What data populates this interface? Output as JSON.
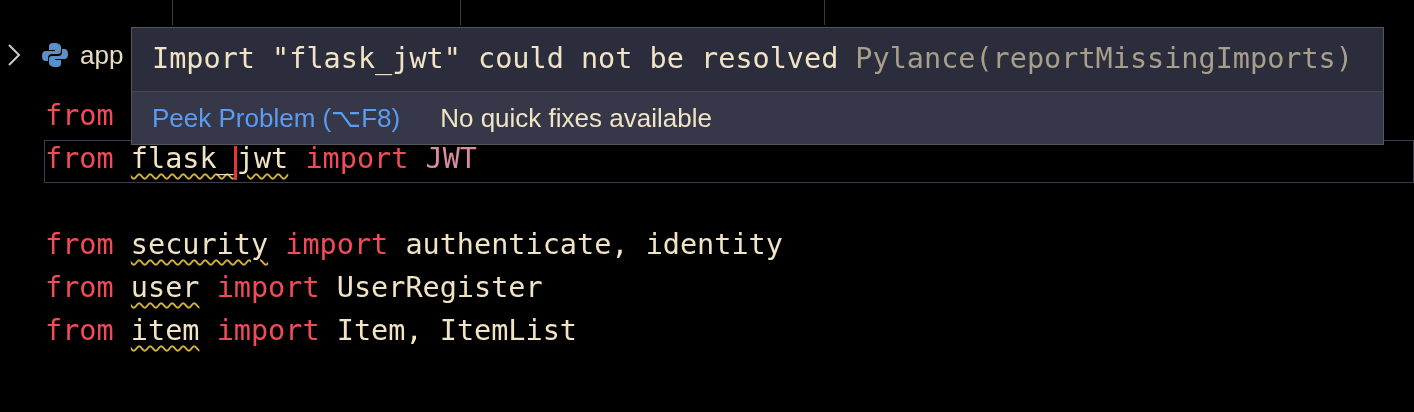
{
  "breadcrumb": {
    "items": [
      "app"
    ]
  },
  "editor": {
    "lines": [
      {
        "kind": "code",
        "current": false,
        "tokens": [
          {
            "kind": "keyword",
            "text": "from",
            "squiggle": false
          }
        ]
      },
      {
        "kind": "code",
        "current": true,
        "tokens": [
          {
            "kind": "keyword",
            "text": "from",
            "squiggle": false
          },
          {
            "kind": "module",
            "text": "flask_",
            "squiggle": true
          },
          {
            "kind": "caret"
          },
          {
            "kind": "module",
            "text": "jwt",
            "squiggle": true
          },
          {
            "kind": "keyword",
            "text": "import",
            "squiggle": false
          },
          {
            "kind": "class",
            "text": "JWT",
            "squiggle": false
          }
        ]
      },
      {
        "kind": "blank",
        "current": false
      },
      {
        "kind": "code",
        "current": false,
        "tokens": [
          {
            "kind": "keyword",
            "text": "from",
            "squiggle": false
          },
          {
            "kind": "module",
            "text": "security",
            "squiggle": true
          },
          {
            "kind": "keyword",
            "text": "import",
            "squiggle": false
          },
          {
            "kind": "name",
            "text": "authenticate,",
            "squiggle": false
          },
          {
            "kind": "name",
            "text": "identity",
            "squiggle": false
          }
        ]
      },
      {
        "kind": "code",
        "current": false,
        "tokens": [
          {
            "kind": "keyword",
            "text": "from",
            "squiggle": false
          },
          {
            "kind": "module",
            "text": "user",
            "squiggle": true
          },
          {
            "kind": "keyword",
            "text": "import",
            "squiggle": false
          },
          {
            "kind": "name",
            "text": "UserRegister",
            "squiggle": false
          }
        ]
      },
      {
        "kind": "code",
        "current": false,
        "tokens": [
          {
            "kind": "keyword",
            "text": "from",
            "squiggle": false
          },
          {
            "kind": "module",
            "text": "item",
            "squiggle": true
          },
          {
            "kind": "keyword",
            "text": "import",
            "squiggle": false
          },
          {
            "kind": "name",
            "text": "Item,",
            "squiggle": false
          },
          {
            "kind": "name",
            "text": "ItemList",
            "squiggle": false
          }
        ]
      }
    ]
  },
  "hover": {
    "message": "Import \"flask_jwt\" could not be resolved",
    "source": "Pylance(reportMissingImports)",
    "action": "Peek Problem (⌥F8)",
    "note": "No quick fixes available"
  }
}
